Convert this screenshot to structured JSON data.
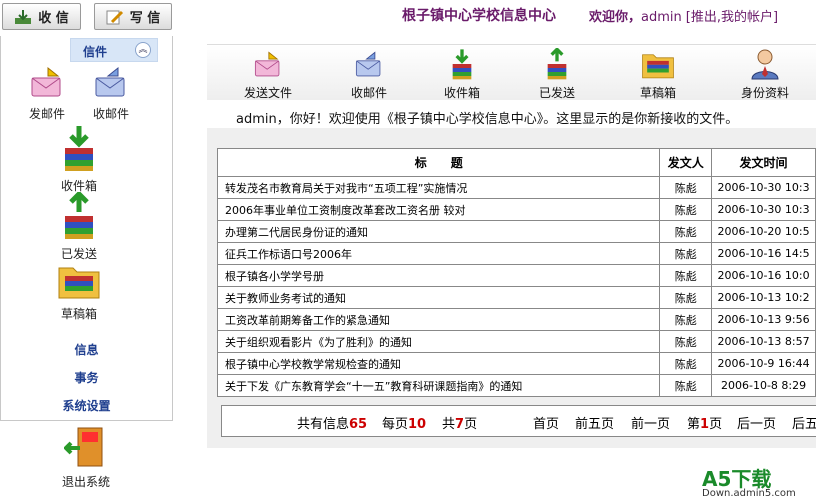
{
  "top_buttons": {
    "receive": "收 信",
    "write": "写 信"
  },
  "header": {
    "site_title": "根子镇中心学校信息中心",
    "welcome_prefix": "欢迎你，",
    "user": "admin",
    "links": "[推出,我的帐户]"
  },
  "sidebar": {
    "section": "信件",
    "items": [
      {
        "label": "发邮件",
        "icon": "send-mail-icon"
      },
      {
        "label": "收邮件",
        "icon": "receive-mail-icon"
      },
      {
        "label": "收件箱",
        "icon": "inbox-icon"
      },
      {
        "label": "已发送",
        "icon": "sent-icon"
      },
      {
        "label": "草稿箱",
        "icon": "drafts-folder-icon"
      }
    ],
    "links": [
      "信息",
      "事务",
      "系统设置"
    ],
    "logout": "退出系统"
  },
  "toolbar": [
    "发送文件",
    "收邮件",
    "收件箱",
    "已发送",
    "草稿箱",
    "身份资料"
  ],
  "greeting": "admin，你好！欢迎使用《根子镇中心学校信息中心》。这里显示的是你新接收的文件。",
  "table": {
    "headers": [
      "标　　题",
      "发文人",
      "发文时间"
    ],
    "rows": [
      {
        "title": "转发茂名市教育局关于对我市“五项工程”实施情况",
        "sender": "陈彪",
        "time": "2006-10-30 10:3"
      },
      {
        "title": "2006年事业单位工资制度改革套改工资名册 较对",
        "sender": "陈彪",
        "time": "2006-10-30 10:3"
      },
      {
        "title": "办理第二代居民身份证的通知",
        "sender": "陈彪",
        "time": "2006-10-20 10:5"
      },
      {
        "title": "征兵工作标语口号2006年",
        "sender": "陈彪",
        "time": "2006-10-16 14:5"
      },
      {
        "title": "根子镇各小学学号册",
        "sender": "陈彪",
        "time": "2006-10-16 10:0"
      },
      {
        "title": "关于教师业务考试的通知",
        "sender": "陈彪",
        "time": "2006-10-13 10:2"
      },
      {
        "title": "工资改革前期筹备工作的紧急通知",
        "sender": "陈彪",
        "time": "2006-10-13 9:56"
      },
      {
        "title": "关于组织观看影片《为了胜利》的通知",
        "sender": "陈彪",
        "time": "2006-10-13 8:57"
      },
      {
        "title": "根子镇中心学校教学常规检查的通知",
        "sender": "陈彪",
        "time": "2006-10-9 16:44"
      },
      {
        "title": "关于下发《广东教育学会“十一五”教育科研课题指南》的通知",
        "sender": "陈彪",
        "time": "2006-10-8 8:29"
      }
    ]
  },
  "pager": {
    "total_prefix": "共有信息",
    "total": "65",
    "per_prefix": "每页",
    "per": "10",
    "pages_prefix": "共",
    "pages": "7",
    "pages_suffix": "页",
    "first": "首页",
    "prev5": "前五页",
    "prev": "前一页",
    "cur_prefix": "第",
    "cur": "1",
    "cur_suffix": "页",
    "next": "后一页",
    "next5": "后五"
  },
  "watermark": {
    "brand": "A5下载",
    "url": "Down.admin5.com"
  },
  "colors": {
    "title": "#6a1b6a",
    "link": "#1f3f8f",
    "accent_red": "#cc0000"
  }
}
